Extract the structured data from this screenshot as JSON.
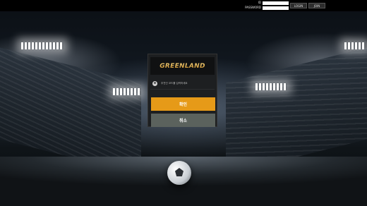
{
  "topbar": {
    "id_label": "ID",
    "password_label": "PASSWORD",
    "id_value": "",
    "password_value": "",
    "login_button": "LOGIN",
    "join_button": "JOIN"
  },
  "dialog": {
    "logo_text": "GREENLAND",
    "message": "추천인 코드를 입력하세요",
    "confirm_button": "확인",
    "cancel_button": "취소"
  },
  "colors": {
    "confirm": "#e69a18",
    "cancel": "#5b625d",
    "logo_gold": "#d9a545"
  },
  "icons": [
    "user-icon"
  ]
}
